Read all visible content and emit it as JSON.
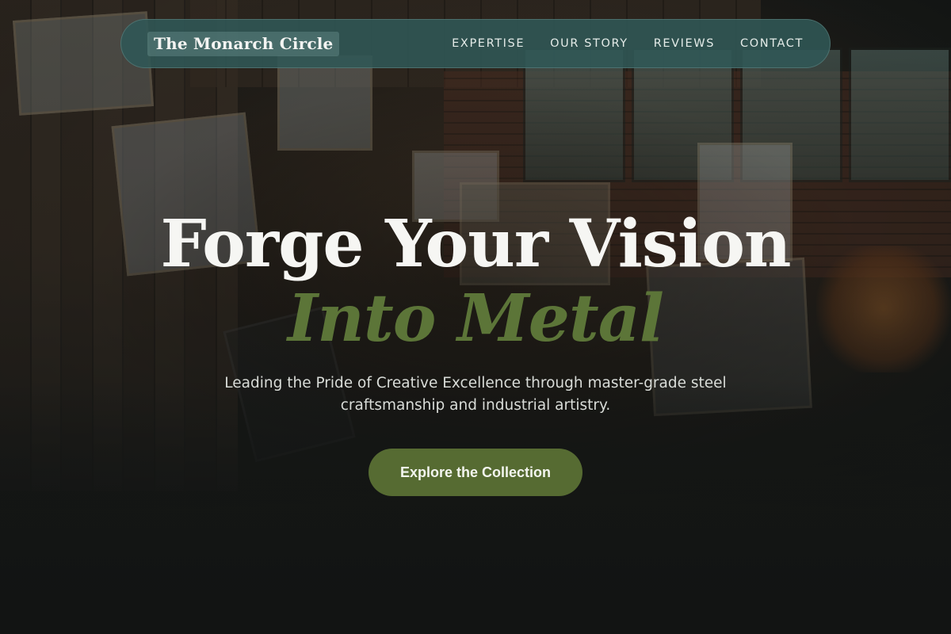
{
  "nav": {
    "brand": "The Monarch Circle",
    "links": [
      {
        "label": "EXPERTISE"
      },
      {
        "label": "OUR STORY"
      },
      {
        "label": "REVIEWS"
      },
      {
        "label": "CONTACT"
      }
    ]
  },
  "hero": {
    "title": "Forge Your Vision",
    "accent": "Into Metal",
    "subtitle": "Leading the Pride of Creative Excellence through master-grade steel craftsmanship and industrial artistry.",
    "cta_label": "Explore the Collection"
  },
  "colors": {
    "nav_bg": "#305856",
    "accent_green": "#5c7538",
    "cta_bg": "#566b32",
    "page_bg": "#121413"
  }
}
